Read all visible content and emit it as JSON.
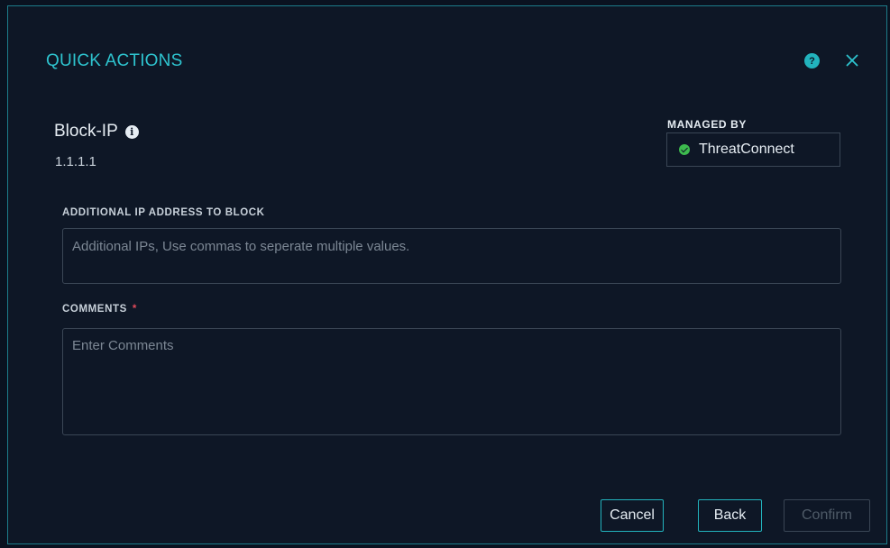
{
  "modal": {
    "title": "QUICK ACTIONS",
    "help_glyph": "?",
    "close_icon": "close-icon"
  },
  "action": {
    "name": "Block-IP",
    "info_glyph": "i",
    "ip": "1.1.1.1"
  },
  "managed_by": {
    "label": "MANAGED BY",
    "value": "ThreatConnect",
    "status": "active",
    "status_color": "#3dbb4e"
  },
  "fields": {
    "additional_ip": {
      "label": "ADDITIONAL IP ADDRESS TO BLOCK",
      "value": "",
      "placeholder": "Additional IPs, Use commas to seperate multiple values."
    },
    "comments": {
      "label": "COMMENTS",
      "required_mark": "*",
      "value": "",
      "placeholder": "Enter Comments"
    }
  },
  "buttons": {
    "cancel": "Cancel",
    "back": "Back",
    "confirm": "Confirm"
  },
  "colors": {
    "accent": "#2ec4cf",
    "background": "#0e1726",
    "required": "#e04a5a"
  }
}
